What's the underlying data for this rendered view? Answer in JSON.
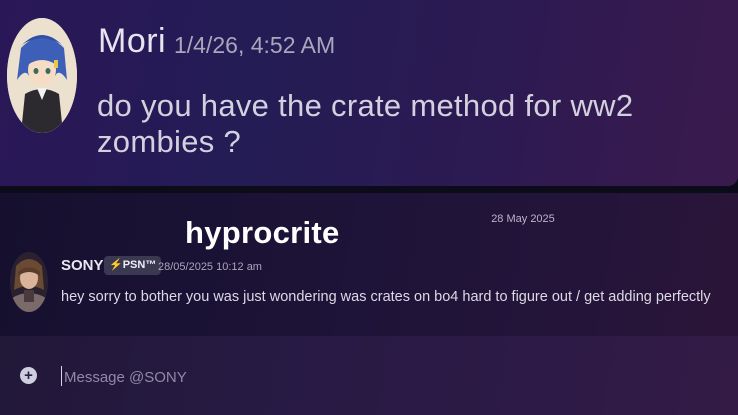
{
  "top_message": {
    "username": "Mori",
    "timestamp": "1/4/26, 4:52 AM",
    "text": "do you have the crate method for ww2 zombies ?",
    "avatar_icon": "anime-character-avatar"
  },
  "overlay_caption": "hyprocrite",
  "conversation": {
    "date_divider": "28 May 2025",
    "message": {
      "username": "SONY",
      "badge": "⚡PSN™",
      "timestamp": "28/05/2025 10:12 am",
      "text": "hey sorry to bother you was just wondering was crates on bo4 hard to figure out / get adding perfectly",
      "avatar_icon": "character-avatar"
    }
  },
  "composer": {
    "placeholder": "Message @SONY",
    "add_icon": "plus-circle-icon"
  },
  "colors": {
    "top_bg": "#2a1757",
    "bottom_bg": "#1c1337",
    "text": "#dcdae6",
    "muted": "#a9a7bb"
  }
}
